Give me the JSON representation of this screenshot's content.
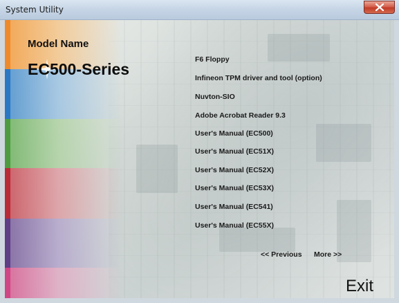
{
  "window": {
    "title": "System Utility"
  },
  "header": {
    "model_label": "Model Name",
    "model_series": "EC500-Series"
  },
  "menu": {
    "items": [
      {
        "label": "F6 Floppy"
      },
      {
        "label": "Infineon TPM driver and tool (option)"
      },
      {
        "label": "Nuvton-SIO"
      },
      {
        "label": "Adobe Acrobat Reader 9.3"
      },
      {
        "label": "User's Manual (EC500)"
      },
      {
        "label": "User's Manual (EC51X)"
      },
      {
        "label": "User's Manual (EC52X)"
      },
      {
        "label": "User's Manual (EC53X)"
      },
      {
        "label": "User's Manual (EC541)"
      },
      {
        "label": "User's Manual (EC55X)"
      }
    ]
  },
  "nav": {
    "previous": "<< Previous",
    "more": "More >>"
  },
  "footer": {
    "exit": "Exit"
  },
  "colors": {
    "orange": "#f39a3b",
    "blue": "#2f80c8",
    "green": "#5aa84a",
    "red": "#c5343f",
    "purple": "#6b4a92",
    "pink": "#d8528c"
  }
}
